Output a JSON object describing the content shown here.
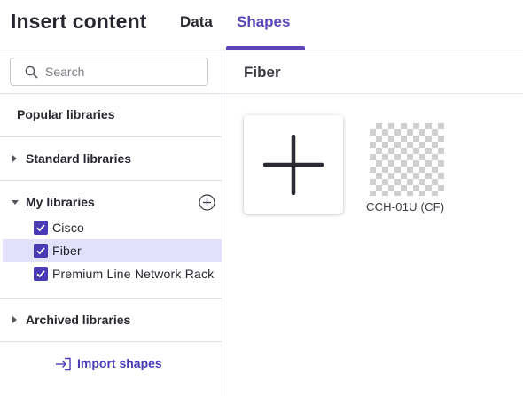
{
  "header": {
    "title": "Insert content",
    "tabs": [
      {
        "label": "Data",
        "active": false
      },
      {
        "label": "Shapes",
        "active": true
      }
    ],
    "accent_color": "#5b45b8"
  },
  "sidebar": {
    "search": {
      "placeholder": "Search",
      "value": ""
    },
    "sections": {
      "popular": "Popular libraries",
      "standard": "Standard libraries",
      "my": "My libraries",
      "archived": "Archived libraries"
    },
    "my_libraries": [
      {
        "label": "Cisco",
        "checked": true,
        "selected": false
      },
      {
        "label": "Fiber",
        "checked": true,
        "selected": true
      },
      {
        "label": "Premium Line Network Rack",
        "checked": true,
        "selected": false
      }
    ],
    "import_label": "Import shapes",
    "selected_color": "#e3e0fb",
    "checkbox_color": "#4a3bb5"
  },
  "main": {
    "title": "Fiber",
    "shapes": [
      {
        "label": "CCH-01U (CF)",
        "icon": "transparent-checkerboard-thumbnail"
      }
    ],
    "add_tile_icon": "plus-icon"
  }
}
